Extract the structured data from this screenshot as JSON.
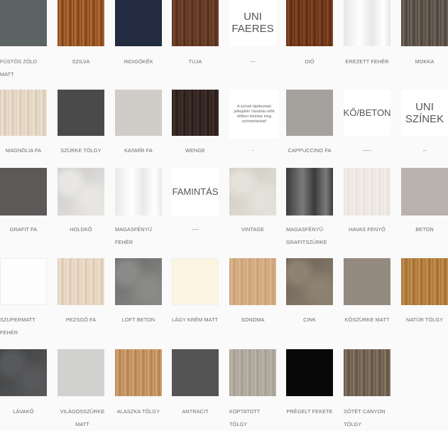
{
  "swatches": [
    {
      "label": "FÜSTÖS ZÖLD MATT",
      "kind": "color",
      "color": "#5c6463"
    },
    {
      "label": "SZILVA",
      "kind": "wood",
      "c1": "#7a3f16",
      "c2": "#b9703a"
    },
    {
      "label": "INDIGÓKÉK",
      "kind": "color",
      "color": "#232c40"
    },
    {
      "label": "TUJA",
      "kind": "wood",
      "c1": "#4f2d1a",
      "c2": "#7a4a30"
    },
    {
      "label": "---",
      "kind": "text",
      "text": "UNI\nFAERES"
    },
    {
      "label": "DIÓ",
      "kind": "wood",
      "c1": "#552914",
      "c2": "#8d4a22"
    },
    {
      "label": "EREZETT FEHÉR",
      "kind": "gloss",
      "c1": "#e6e6e6",
      "c2": "#ffffff"
    },
    {
      "label": "MOKKA",
      "kind": "wood",
      "c1": "#4a4038",
      "c2": "#756a60"
    },
    {
      "label": "MAGNÓLIA FA",
      "kind": "wood",
      "c1": "#d8c9b4",
      "c2": "#efe4d5"
    },
    {
      "label": "SZÜRKE TÖLGY",
      "kind": "color",
      "color": "#4a4a4b"
    },
    {
      "label": "KASMÍR FA",
      "kind": "color",
      "color": "#d0cdc8"
    },
    {
      "label": "WENGE",
      "kind": "wood",
      "c1": "#261a16",
      "c2": "#453430"
    },
    {
      "label": "-",
      "kind": "notice",
      "text": "A színek tájékoztató jellegűek! Vásárlás előtt élőben tekintse meg színmintánkat!"
    },
    {
      "label": "CAPPUCCINO FA",
      "kind": "color",
      "color": "#a5a29d"
    },
    {
      "label": "-----",
      "kind": "text",
      "text": "KŐ/BETON"
    },
    {
      "label": "--",
      "kind": "text",
      "text": "UNI\nSZÍNEK"
    },
    {
      "label": "GRAFIT FA",
      "kind": "color",
      "color": "#5b5a59"
    },
    {
      "label": "HOLDKŐ",
      "kind": "stone",
      "c1": "#c9c8c6",
      "c2": "#e8e7e4"
    },
    {
      "label": "MAGASFÉNYŰ FEHÉR",
      "kind": "gloss",
      "c1": "#e9e9e9",
      "c2": "#ffffff"
    },
    {
      "label": "----",
      "kind": "text",
      "text": "FAMINTÁS"
    },
    {
      "label": "VINTAGE",
      "kind": "stone",
      "c1": "#cfcbc1",
      "c2": "#e4e1da"
    },
    {
      "label": "MAGASFÉNYŰ GRAFITSZÜRKE",
      "kind": "gloss",
      "c1": "#3b3b3c",
      "c2": "#7b7b7c"
    },
    {
      "label": "HAVAS FENYŐ",
      "kind": "wood",
      "c1": "#e7e2da",
      "c2": "#f3efea"
    },
    {
      "label": "BETON",
      "kind": "color",
      "color": "#b8b3ac"
    },
    {
      "label": "SZUPERMATT FEHÉR",
      "kind": "color",
      "color": "#fdfdfd"
    },
    {
      "label": "PEZSGŐ FA",
      "kind": "wood",
      "c1": "#dcc7ae",
      "c2": "#f1e4d4"
    },
    {
      "label": "LOFT BETON",
      "kind": "stone",
      "c1": "#6a6b69",
      "c2": "#8a8b88"
    },
    {
      "label": "LÁGY KRÉM MATT",
      "kind": "color",
      "color": "#fbf5e2"
    },
    {
      "label": "SONOMA",
      "kind": "wood",
      "c1": "#c99e73",
      "c2": "#ddb992"
    },
    {
      "label": "CINK",
      "kind": "stone",
      "c1": "#6a5f52",
      "c2": "#8e8272"
    },
    {
      "label": "KŐSZÜRKE MATT",
      "kind": "color",
      "color": "#948a80"
    },
    {
      "label": "NATÚR TÖLGY",
      "kind": "wood",
      "c1": "#9c6a33",
      "c2": "#c9944f"
    },
    {
      "label": "LÁVAKŐ",
      "kind": "stone",
      "c1": "#404142",
      "c2": "#58595a"
    },
    {
      "label": "VILÁGOSSZÜRKE MATT",
      "kind": "color",
      "color": "#d1d1cf"
    },
    {
      "label": "ALASZKA TÖLGY",
      "kind": "wood",
      "c1": "#b07f4f",
      "c2": "#d6a874"
    },
    {
      "label": "ANTRACIT",
      "kind": "color",
      "color": "#545454"
    },
    {
      "label": "KOPTATOTT TÖLGY",
      "kind": "wood",
      "c1": "#a29b90",
      "c2": "#bfb8ad"
    },
    {
      "label": "PRÉGELT FEKETE",
      "kind": "color",
      "color": "#080808"
    },
    {
      "label": "SÖTÉT CANYON TÖLGY",
      "kind": "wood",
      "c1": "#5e5042",
      "c2": "#8b7a66"
    }
  ]
}
